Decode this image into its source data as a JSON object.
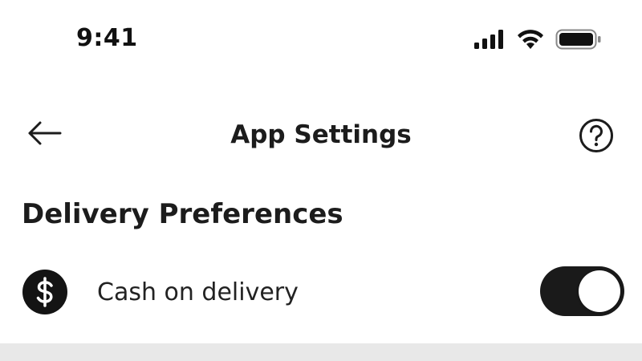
{
  "status_bar": {
    "time": "9:41",
    "icons": [
      "cellular-signal-icon",
      "wifi-icon",
      "battery-icon"
    ]
  },
  "header": {
    "title": "App Settings",
    "back_icon": "arrow-left-icon",
    "help_icon": "question-circle-icon"
  },
  "section": {
    "title": "Delivery Preferences",
    "items": [
      {
        "label": "Cash on delivery",
        "icon": "dollar-circle-icon",
        "enabled": true
      }
    ]
  },
  "colors": {
    "toggle_on": "#1a1a1a",
    "divider": "#e8e8e8",
    "text": "#1c1c1c"
  }
}
